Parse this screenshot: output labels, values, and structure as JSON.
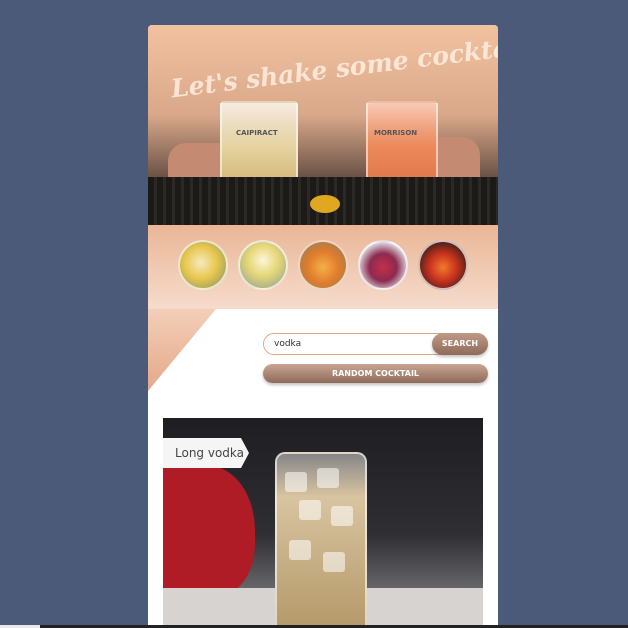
{
  "hero": {
    "title": "Let's shake some cocktails!",
    "glass_left_label": "CAIPIRACT",
    "glass_right_label": "MORRISON"
  },
  "thumbnails": [
    {
      "name": "cocktail-thumb-lemon"
    },
    {
      "name": "cocktail-thumb-martini"
    },
    {
      "name": "cocktail-thumb-citrus"
    },
    {
      "name": "cocktail-thumb-berry"
    },
    {
      "name": "cocktail-thumb-sunrise"
    }
  ],
  "search": {
    "value": "vodka",
    "button_label": "SEARCH"
  },
  "random": {
    "button_label": "RANDOM COCKTAIL"
  },
  "result": {
    "title": "Long vodka"
  },
  "colors": {
    "page_background": "#4a5a78",
    "accent": "#8e6a58",
    "peach": "#eab696"
  }
}
